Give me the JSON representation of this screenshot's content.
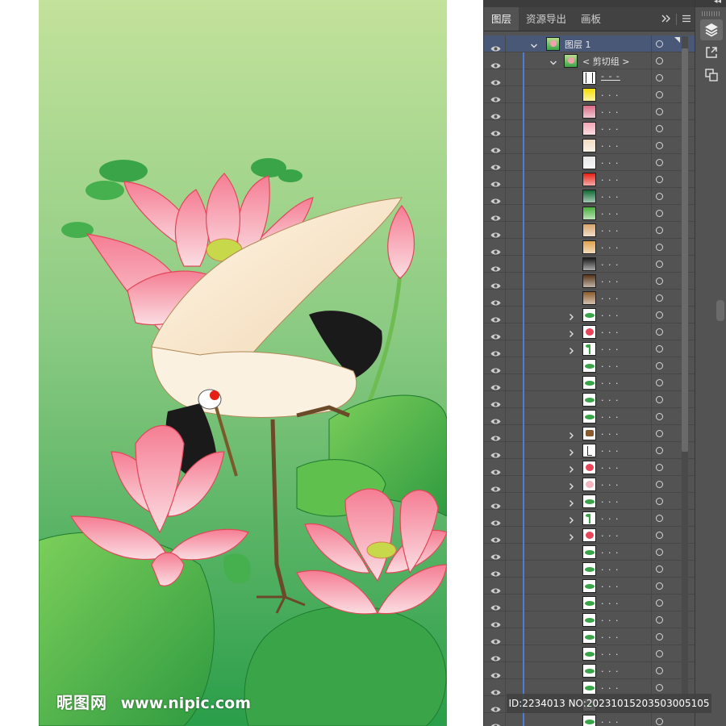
{
  "panel": {
    "tabs": [
      {
        "label": "图层",
        "active": true
      },
      {
        "label": "资源导出",
        "active": false
      },
      {
        "label": "画板",
        "active": false
      }
    ],
    "overflow_icon": "double-chevron-icon",
    "menu_icon": "hamburger-menu-icon",
    "accent_color": "#4d7bd8",
    "selected_row_color": "#4a5878"
  },
  "layers": [
    {
      "name": "图层 1",
      "indent": 0,
      "expand": "open",
      "thumb": "art",
      "selected": true
    },
    {
      "name": "< 剪切组 >",
      "indent": 1,
      "expand": "open",
      "thumb": "art"
    },
    {
      "name": "- - -",
      "indent": 2,
      "expand": "none",
      "thumb": "white-frame",
      "underline": true
    },
    {
      "name": ". . .",
      "indent": 2,
      "expand": "none",
      "thumb": "#f6dd00"
    },
    {
      "name": ". . .",
      "indent": 2,
      "expand": "none",
      "thumb": "#d96b86"
    },
    {
      "name": ". . .",
      "indent": 2,
      "expand": "none",
      "thumb": "#f2a6b5"
    },
    {
      "name": ". . .",
      "indent": 2,
      "expand": "none",
      "thumb": "#f2dcc2"
    },
    {
      "name": ". . .",
      "indent": 2,
      "expand": "none",
      "thumb": "#e8e8e8"
    },
    {
      "name": ". . .",
      "indent": 2,
      "expand": "none",
      "thumb": "#e61e14"
    },
    {
      "name": ". . .",
      "indent": 2,
      "expand": "none",
      "thumb": "#0f6b33"
    },
    {
      "name": ". . .",
      "indent": 2,
      "expand": "none",
      "thumb": "#48b03c"
    },
    {
      "name": ". . .",
      "indent": 2,
      "expand": "none",
      "thumb": "#d7a46a"
    },
    {
      "name": ". . .",
      "indent": 2,
      "expand": "none",
      "thumb": "#e0a34c"
    },
    {
      "name": ". . .",
      "indent": 2,
      "expand": "none",
      "thumb": "#1a1a1a"
    },
    {
      "name": ". . .",
      "indent": 2,
      "expand": "none",
      "thumb": "#5a3417"
    },
    {
      "name": ". . .",
      "indent": 2,
      "expand": "none",
      "thumb": "#8a5a2b"
    },
    {
      "name": ". . .",
      "indent": 2,
      "expand": "closed",
      "thumb": "leaf"
    },
    {
      "name": ". . .",
      "indent": 2,
      "expand": "closed",
      "thumb": "flower"
    },
    {
      "name": ". . .",
      "indent": 2,
      "expand": "closed",
      "thumb": "stem"
    },
    {
      "name": ". . .",
      "indent": 2,
      "expand": "none",
      "thumb": "leaf"
    },
    {
      "name": ". . .",
      "indent": 2,
      "expand": "none",
      "thumb": "leaf"
    },
    {
      "name": ". . .",
      "indent": 2,
      "expand": "none",
      "thumb": "leaf"
    },
    {
      "name": ". . .",
      "indent": 2,
      "expand": "none",
      "thumb": "leaf"
    },
    {
      "name": ". . .",
      "indent": 2,
      "expand": "closed",
      "thumb": "crane"
    },
    {
      "name": ". . .",
      "indent": 2,
      "expand": "closed",
      "thumb": "sketch"
    },
    {
      "name": ". . .",
      "indent": 2,
      "expand": "closed",
      "thumb": "flower"
    },
    {
      "name": ". . .",
      "indent": 2,
      "expand": "closed",
      "thumb": "flower-pale"
    },
    {
      "name": ". . .",
      "indent": 2,
      "expand": "closed",
      "thumb": "leaf"
    },
    {
      "name": ". . .",
      "indent": 2,
      "expand": "closed",
      "thumb": "stem"
    },
    {
      "name": ". . .",
      "indent": 2,
      "expand": "closed",
      "thumb": "flower"
    },
    {
      "name": ". . .",
      "indent": 2,
      "expand": "none",
      "thumb": "leaf"
    },
    {
      "name": ". . .",
      "indent": 2,
      "expand": "none",
      "thumb": "leaf"
    },
    {
      "name": ". . .",
      "indent": 2,
      "expand": "none",
      "thumb": "leaf"
    },
    {
      "name": ". . .",
      "indent": 2,
      "expand": "none",
      "thumb": "leaf"
    },
    {
      "name": ". . .",
      "indent": 2,
      "expand": "none",
      "thumb": "leaf"
    },
    {
      "name": ". . .",
      "indent": 2,
      "expand": "none",
      "thumb": "leaf"
    },
    {
      "name": ". . .",
      "indent": 2,
      "expand": "none",
      "thumb": "leaf"
    },
    {
      "name": ". . .",
      "indent": 2,
      "expand": "none",
      "thumb": "leaf"
    },
    {
      "name": ". . .",
      "indent": 2,
      "expand": "none",
      "thumb": "leaf"
    },
    {
      "name": ". . .",
      "indent": 2,
      "expand": "none",
      "thumb": "leaf"
    },
    {
      "name": ". . .",
      "indent": 2,
      "expand": "none",
      "thumb": "leaf"
    }
  ],
  "strip": {
    "collapse_icon": "double-chevron-left-icon",
    "tools": [
      {
        "icon": "layers-icon",
        "active": true
      },
      {
        "icon": "export-icon",
        "active": false
      },
      {
        "icon": "arrange-icon",
        "active": false
      }
    ]
  },
  "artwork": {
    "subject": "lotus-and-crane-illustration",
    "colors": {
      "bg_top": "#c3e29b",
      "bg_bottom": "#2a9e4a",
      "petal": "#f2a0ac",
      "petal_line": "#e0485a"
    }
  },
  "watermark": {
    "logo": "昵图网",
    "url": "www.nipic.com"
  },
  "id_banner": "ID:2234013 NO:20231015203503005105"
}
